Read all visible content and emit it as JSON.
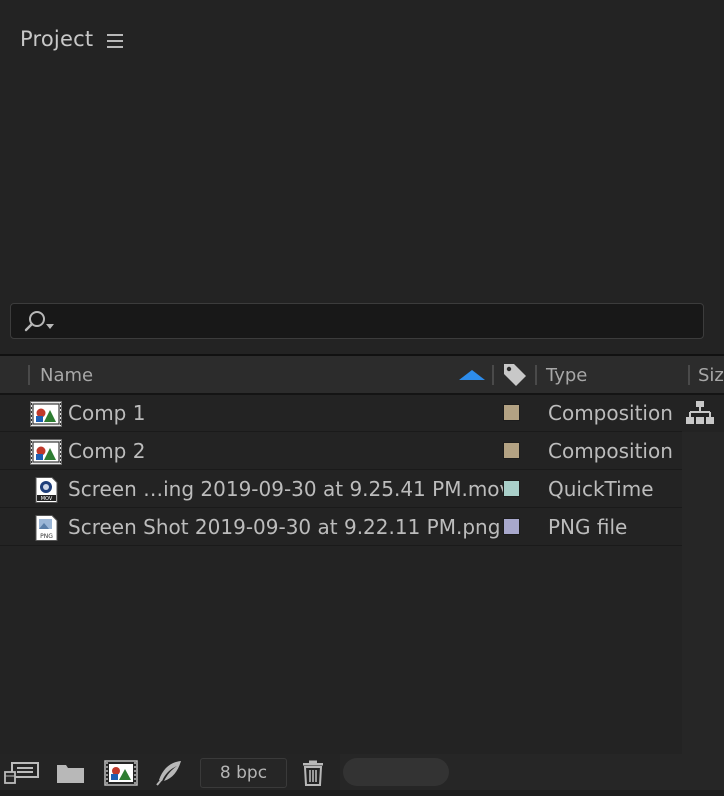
{
  "panel": {
    "title": "Project"
  },
  "search": {
    "placeholder": ""
  },
  "columns": {
    "name": "Name",
    "type": "Type",
    "size": "Siz"
  },
  "rows": [
    {
      "name": "Comp 1",
      "type": "Composition",
      "label_color": "#b3a283",
      "icon": "composition-icon"
    },
    {
      "name": "Comp 2",
      "type": "Composition",
      "label_color": "#b3a283",
      "icon": "composition-icon"
    },
    {
      "name": "Screen …ing 2019-09-30 at 9.25.41 PM.mov",
      "type": "QuickTime",
      "label_color": "#a9cfc9",
      "icon": "mov-file-icon"
    },
    {
      "name": "Screen Shot 2019-09-30 at 9.22.11 PM.png",
      "type": "PNG file",
      "label_color": "#a8a8cc",
      "icon": "png-file-icon"
    }
  ],
  "footer": {
    "bpc": "8 bpc"
  },
  "colors": {
    "sort_arrow": "#2d8ceb",
    "panel_bg": "#232323"
  }
}
